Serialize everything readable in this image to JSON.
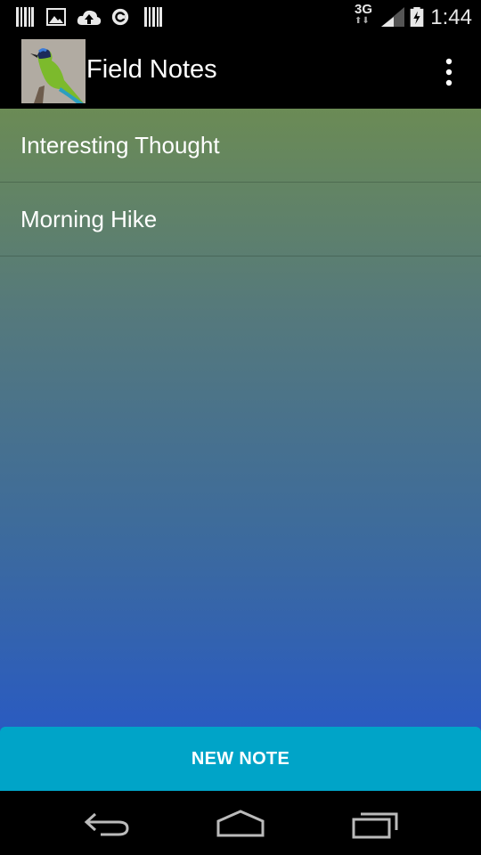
{
  "status_bar": {
    "time": "1:44",
    "network": "3G",
    "icons": [
      "barcode-icon",
      "image-icon",
      "cloud-upload-icon",
      "sync-icon",
      "barcode-icon",
      "network-3g-icon",
      "signal-icon",
      "battery-charging-icon"
    ]
  },
  "action_bar": {
    "title": "Field Notes",
    "logo": "bird-logo-icon",
    "menu": "overflow-menu-icon"
  },
  "notes": [
    {
      "title": "Interesting Thought"
    },
    {
      "title": "Morning Hike"
    }
  ],
  "new_note_label": "NEW NOTE",
  "colors": {
    "gradient_top": "#6b8b55",
    "gradient_bottom": "#2456cc",
    "button": "#00a4c8"
  },
  "nav": [
    "back-icon",
    "home-icon",
    "recent-apps-icon"
  ]
}
